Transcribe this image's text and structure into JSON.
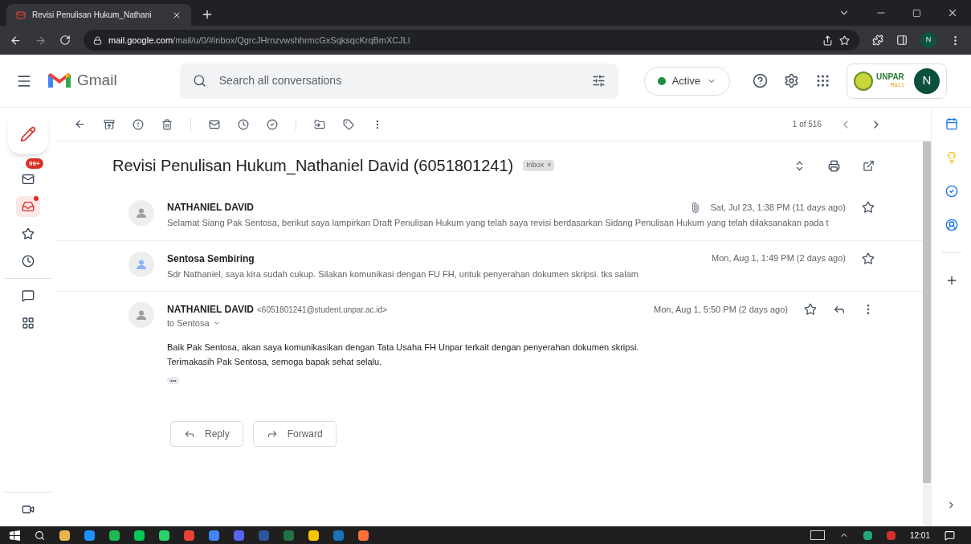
{
  "browser": {
    "tab_title": "Revisi Penulisan Hukum_Nathani",
    "url_host": "mail.google.com",
    "url_path": "/mail/u/0/#inbox/QgrcJHrnzvwshhrmcGxSqksqcKrqBmXCJLl",
    "profile": "N"
  },
  "header": {
    "logo_text": "Gmail",
    "search": {
      "placeholder": "Search all conversations"
    },
    "status": "Active",
    "org_logo": "UNPAR",
    "org_sub": "Mail",
    "avatar": "N"
  },
  "sidebar": {
    "items": [
      {
        "badge": "99+",
        "selected": false,
        "dot": false
      },
      {
        "selected": true,
        "dot": true
      },
      {
        "selected": false,
        "dot": false
      },
      {
        "selected": false,
        "dot": false
      },
      {
        "selected": false,
        "dot": false
      },
      {
        "selected": false,
        "dot": false
      },
      {
        "selected": false,
        "dot": false
      }
    ]
  },
  "toolbar": {
    "pager": "1 of 516"
  },
  "thread": {
    "subject": "Revisi Penulisan Hukum_Nathaniel David (6051801241)",
    "label": "Inbox",
    "label_close": "×",
    "messages": [
      {
        "kind": "collapsed",
        "sender": "NATHANIEL DAVID",
        "attachment": true,
        "date": "Sat, Jul 23, 1:38 PM (11 days ago)",
        "snippet": "Selamat Siang Pak Sentosa, berikut saya lampirkan Draft Penulisan Hukum yang telah saya revisi berdasarkan Sidang Penulisan Hukum yang telah dilaksanakan pada t",
        "color": "#9e9e9e"
      },
      {
        "kind": "collapsed",
        "sender": "Sentosa Sembiring",
        "attachment": false,
        "date": "Mon, Aug 1, 1:49 PM (2 days ago)",
        "snippet": "Sdr Nathaniel, saya kira sudah cukup. Silakan komunikasi dengan FU FH, untuk penyerahan dokumen skripsi. tks salam",
        "color": "#8ab4f8"
      },
      {
        "kind": "expanded",
        "sender": "NATHANIEL DAVID",
        "email": "<6051801241@student.unpar.ac.id>",
        "to": "to Sentosa",
        "attachment": false,
        "date": "Mon, Aug 1, 5:50 PM (2 days ago)",
        "body": [
          "Baik Pak Sentosa, akan saya komunikasikan dengan Tata Usaha FH Unpar terkait dengan penyerahan dokumen skripsi.",
          "Terimakasih Pak Sentosa, semoga bapak sehat selalu."
        ],
        "trimmed": "•••",
        "color": "#9e9e9e"
      }
    ],
    "actions": [
      "Reply",
      "Forward"
    ]
  },
  "taskbar": {
    "clock": "12:01"
  }
}
